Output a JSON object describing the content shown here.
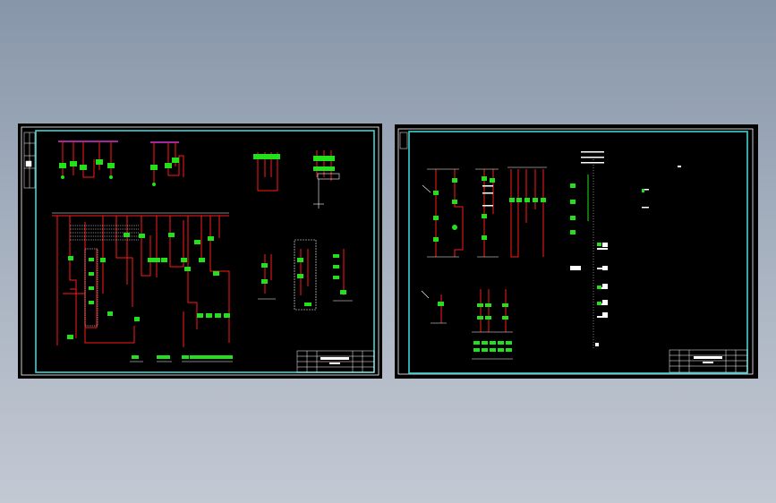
{
  "colors": {
    "background_top": "#8796a9",
    "background_bottom": "#c3c9d3",
    "sheet": "#000000",
    "frame": "#3fd2d2",
    "border": "#ffffff",
    "wire": "#ff1a1a",
    "component": "#22e01c",
    "bus": "#ff40ff",
    "text": "#ffffff"
  },
  "icons": {
    "component": "component-symbol-icon",
    "switch": "switch-icon",
    "meter": "meter-circle-icon"
  }
}
